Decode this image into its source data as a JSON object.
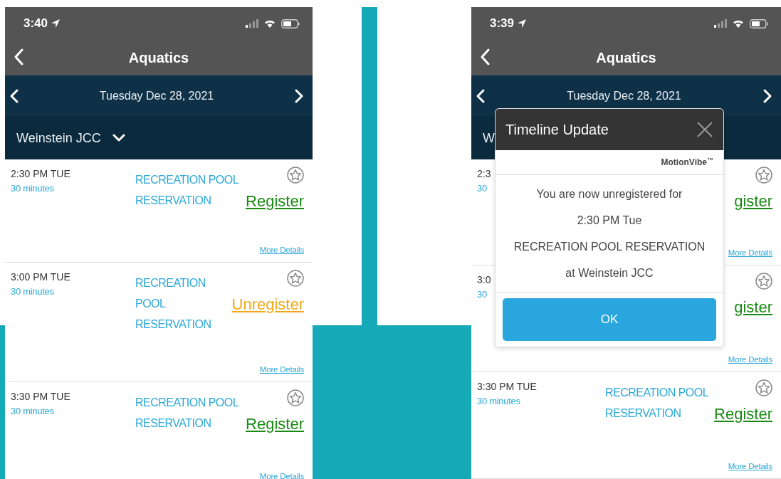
{
  "screens": [
    {
      "status_time": "3:40",
      "title": "Aquatics",
      "date": "Tuesday Dec 28, 2021",
      "location": "Weinstein JCC",
      "events": [
        {
          "time": "2:30 PM TUE",
          "duration": "30 minutes",
          "name_lines": [
            "RECREATION POOL",
            "RESERVATION"
          ],
          "action": {
            "kind": "register",
            "label": "Register"
          },
          "details": "More Details"
        },
        {
          "time": "3:00 PM TUE",
          "duration": "30 minutes",
          "name_lines": [
            "RECREATION",
            "POOL",
            "RESERVATION"
          ],
          "action": {
            "kind": "unregister",
            "label": "Unregister"
          },
          "details": "More Details"
        },
        {
          "time": "3:30 PM TUE",
          "duration": "30 minutes",
          "name_lines": [
            "RECREATION POOL",
            "RESERVATION"
          ],
          "action": {
            "kind": "register",
            "label": "Register"
          },
          "details": "More Details"
        }
      ]
    },
    {
      "status_time": "3:39",
      "title": "Aquatics",
      "date": "Tuesday Dec 28, 2021",
      "location": "W",
      "events": [
        {
          "time": "2:3",
          "duration": "30",
          "action": {
            "kind": "register",
            "label": "gister"
          },
          "details": "More Details"
        },
        {
          "time": "3:0",
          "duration": "30",
          "action": {
            "kind": "register",
            "label": "gister"
          },
          "details": "More Details"
        },
        {
          "time": "3:30 PM TUE",
          "duration": "30 minutes",
          "name_lines": [
            "RECREATION POOL",
            "RESERVATION"
          ],
          "action": {
            "kind": "register",
            "label": "Register"
          },
          "details": "More Details"
        }
      ],
      "dialog": {
        "title": "Timeline Update",
        "brand": "MotionVibe$^{™}$",
        "lines": [
          "You are now unregistered for",
          "2:30 PM Tue",
          "RECREATION POOL RESERVATION",
          "at Weinstein JCC"
        ],
        "button": "OK"
      }
    }
  ]
}
